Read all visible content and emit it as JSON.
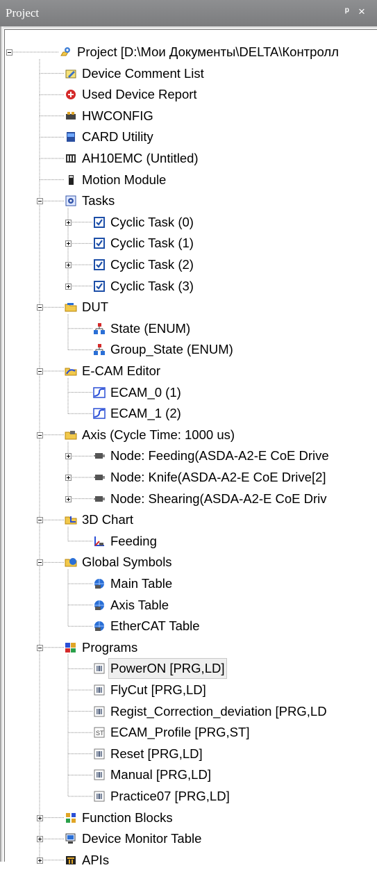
{
  "panel": {
    "title": "Project",
    "pin_icon": "pin-icon",
    "close_glyph": "×"
  },
  "tree": [
    {
      "key": "project",
      "label": "Project [D:\\Мои Документы\\DELTA\\Контролл",
      "icon": "project-gear-icon",
      "level": 0,
      "toggle": "minus"
    },
    {
      "key": "device-comment-list",
      "label": "Device Comment List",
      "icon": "comment-pencil-icon",
      "level": 1,
      "toggle": null
    },
    {
      "key": "used-device-report",
      "label": "Used Device Report",
      "icon": "device-report-icon",
      "level": 1,
      "toggle": null
    },
    {
      "key": "hwconfig",
      "label": "HWCONFIG",
      "icon": "hwconfig-icon",
      "level": 1,
      "toggle": null
    },
    {
      "key": "card-utility",
      "label": "CARD Utility",
      "icon": "card-icon",
      "level": 1,
      "toggle": null
    },
    {
      "key": "ah10emc",
      "label": "AH10EMC  (Untitled)",
      "icon": "plc-icon",
      "level": 1,
      "toggle": null
    },
    {
      "key": "motion-module",
      "label": "Motion Module",
      "icon": "module-icon",
      "level": 1,
      "toggle": null
    },
    {
      "key": "tasks",
      "label": "Tasks",
      "icon": "tasks-gear-icon",
      "level": 1,
      "toggle": "minus"
    },
    {
      "key": "cyclic-task-0",
      "label": "Cyclic Task (0)",
      "icon": "checkbox-icon",
      "level": 2,
      "toggle": "plus"
    },
    {
      "key": "cyclic-task-1",
      "label": "Cyclic Task (1)",
      "icon": "checkbox-icon",
      "level": 2,
      "toggle": "plus"
    },
    {
      "key": "cyclic-task-2",
      "label": "Cyclic Task (2)",
      "icon": "checkbox-icon",
      "level": 2,
      "toggle": "plus"
    },
    {
      "key": "cyclic-task-3",
      "label": "Cyclic Task (3)",
      "icon": "checkbox-icon",
      "level": 2,
      "toggle": "plus"
    },
    {
      "key": "dut",
      "label": "DUT",
      "icon": "folder-dut-icon",
      "level": 1,
      "toggle": "minus"
    },
    {
      "key": "state-enum",
      "label": "State (ENUM)",
      "icon": "enum-icon",
      "level": 2,
      "toggle": null
    },
    {
      "key": "group-state-enum",
      "label": "Group_State (ENUM)",
      "icon": "enum-icon",
      "level": 2,
      "toggle": null
    },
    {
      "key": "ecam-editor",
      "label": "E-CAM Editor",
      "icon": "folder-ecam-icon",
      "level": 1,
      "toggle": "minus"
    },
    {
      "key": "ecam-0",
      "label": "ECAM_0 (1)",
      "icon": "cam-curve-icon",
      "level": 2,
      "toggle": null
    },
    {
      "key": "ecam-1",
      "label": "ECAM_1 (2)",
      "icon": "cam-curve-icon",
      "level": 2,
      "toggle": null
    },
    {
      "key": "axis",
      "label": "Axis (Cycle Time: 1000 us)",
      "icon": "folder-axis-icon",
      "level": 1,
      "toggle": "minus"
    },
    {
      "key": "node-feeding",
      "label": "Node: Feeding(ASDA-A2-E CoE Drive",
      "icon": "servo-icon",
      "level": 2,
      "toggle": "plus"
    },
    {
      "key": "node-knife",
      "label": "Node: Knife(ASDA-A2-E CoE Drive[2]",
      "icon": "servo-icon",
      "level": 2,
      "toggle": "plus"
    },
    {
      "key": "node-shearing",
      "label": "Node: Shearing(ASDA-A2-E CoE Driv",
      "icon": "servo-icon",
      "level": 2,
      "toggle": "plus"
    },
    {
      "key": "3d-chart",
      "label": "3D Chart",
      "icon": "folder-chart-icon",
      "level": 1,
      "toggle": "minus"
    },
    {
      "key": "chart-feeding",
      "label": "Feeding",
      "icon": "chart-axis-icon",
      "level": 2,
      "toggle": null
    },
    {
      "key": "global-symbols",
      "label": "Global Symbols",
      "icon": "folder-globe-icon",
      "level": 1,
      "toggle": "minus"
    },
    {
      "key": "main-table",
      "label": "Main Table",
      "icon": "table-globe-icon",
      "level": 2,
      "toggle": null
    },
    {
      "key": "axis-table",
      "label": "Axis Table",
      "icon": "table-globe-icon",
      "level": 2,
      "toggle": null
    },
    {
      "key": "ethercat-table",
      "label": "EtherCAT Table",
      "icon": "table-globe-icon",
      "level": 2,
      "toggle": null
    },
    {
      "key": "programs",
      "label": "Programs",
      "icon": "programs-blocks-icon",
      "level": 1,
      "toggle": "minus"
    },
    {
      "key": "poweron",
      "label": "PowerON [PRG,LD]",
      "icon": "ld-program-icon",
      "level": 2,
      "toggle": null,
      "selected": true
    },
    {
      "key": "flycut",
      "label": "FlyCut [PRG,LD]",
      "icon": "ld-program-icon",
      "level": 2,
      "toggle": null
    },
    {
      "key": "regist-correction",
      "label": "Regist_Correction_deviation [PRG,LD",
      "icon": "ld-program-icon",
      "level": 2,
      "toggle": null
    },
    {
      "key": "ecam-profile",
      "label": "ECAM_Profile [PRG,ST]",
      "icon": "st-program-icon",
      "level": 2,
      "toggle": null
    },
    {
      "key": "reset",
      "label": "Reset [PRG,LD]",
      "icon": "ld-program-icon",
      "level": 2,
      "toggle": null
    },
    {
      "key": "manual",
      "label": "Manual [PRG,LD]",
      "icon": "ld-program-icon",
      "level": 2,
      "toggle": null
    },
    {
      "key": "practice07",
      "label": "Practice07 [PRG,LD]",
      "icon": "ld-program-icon",
      "level": 2,
      "toggle": null
    },
    {
      "key": "function-blocks",
      "label": "Function Blocks",
      "icon": "function-blocks-icon",
      "level": 1,
      "toggle": "plus"
    },
    {
      "key": "device-monitor-table",
      "label": "Device Monitor Table",
      "icon": "monitor-icon",
      "level": 1,
      "toggle": "plus"
    },
    {
      "key": "apis",
      "label": "APIs",
      "icon": "api-icon",
      "level": 1,
      "toggle": "plus"
    }
  ]
}
